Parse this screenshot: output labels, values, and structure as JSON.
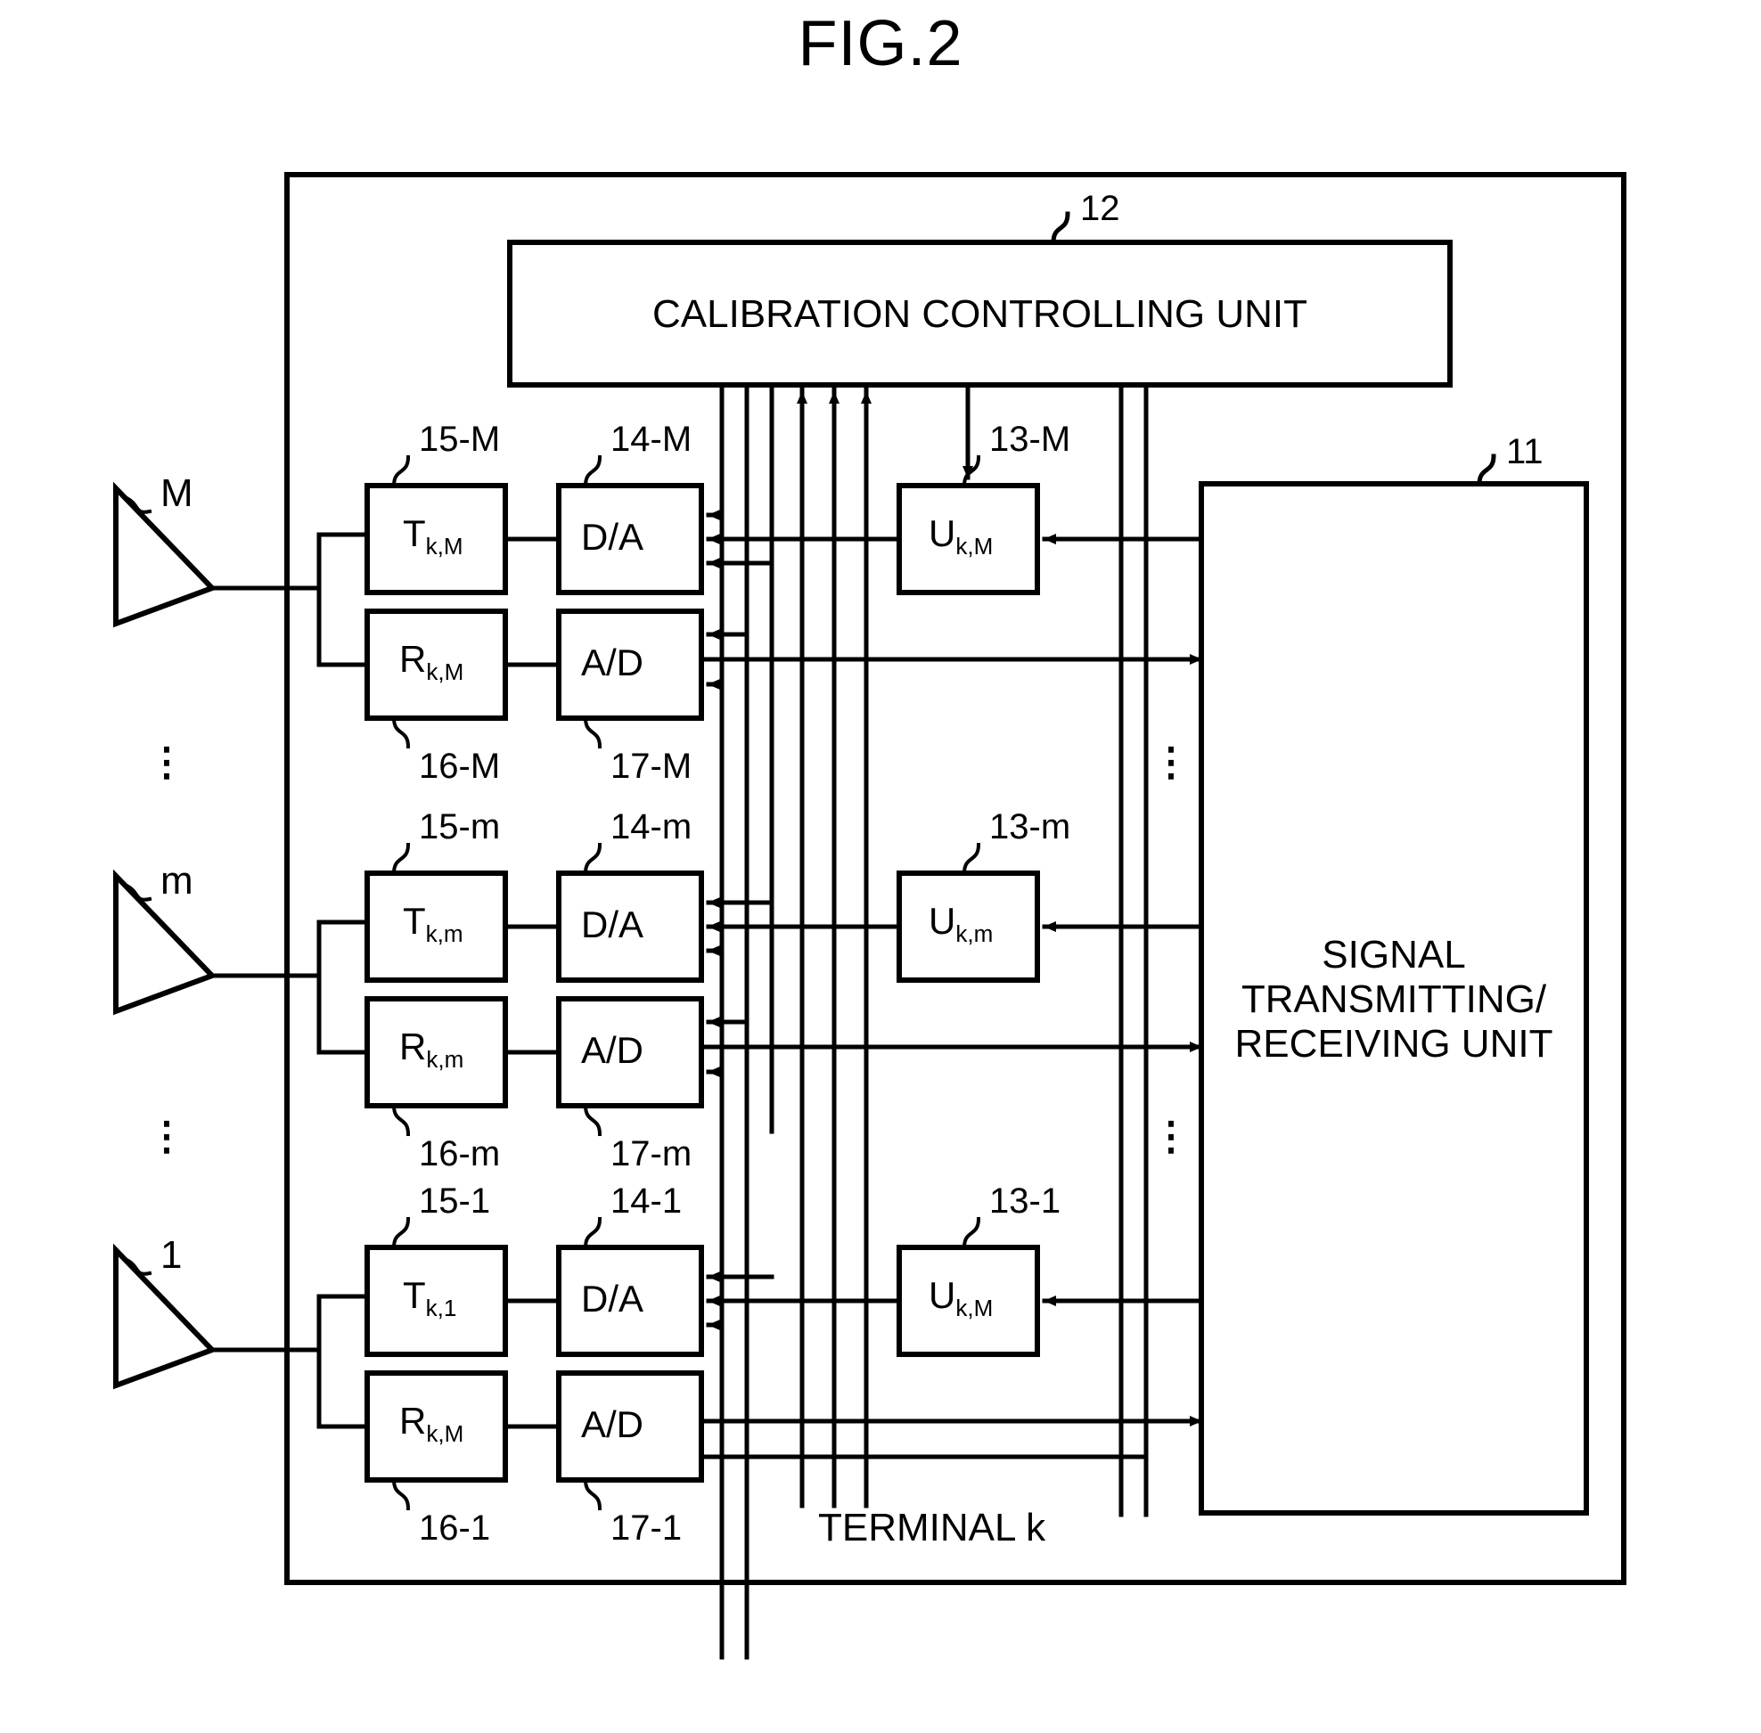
{
  "figure": {
    "title": "FIG.2",
    "terminal_label": "TERMINAL k"
  },
  "outer_box": {
    "name": "terminal-k-enclosure"
  },
  "calibration_unit": {
    "label": "CALIBRATION CONTROLLING UNIT",
    "ref": "12"
  },
  "signal_unit": {
    "line1": "SIGNAL",
    "line2": "TRANSMITTING/",
    "line3": "RECEIVING UNIT",
    "ref": "11"
  },
  "antennas": [
    {
      "label": "M"
    },
    {
      "label": "m"
    },
    {
      "label": "1"
    }
  ],
  "rows": [
    {
      "id": "M",
      "tx": {
        "label": "T",
        "sub": "k,M",
        "ref": "15-M"
      },
      "da": {
        "label": "D/A",
        "ref": "14-M"
      },
      "rx": {
        "label": "R",
        "sub": "k,M",
        "ref": "16-M"
      },
      "ad": {
        "label": "A/D",
        "ref": "17-M"
      },
      "u": {
        "label": "U",
        "sub": "k,M",
        "ref": "13-M"
      }
    },
    {
      "id": "m",
      "tx": {
        "label": "T",
        "sub": "k,m",
        "ref": "15-m"
      },
      "da": {
        "label": "D/A",
        "ref": "14-m"
      },
      "rx": {
        "label": "R",
        "sub": "k,m",
        "ref": "16-m"
      },
      "ad": {
        "label": "A/D",
        "ref": "17-m"
      },
      "u": {
        "label": "U",
        "sub": "k,m",
        "ref": "13-m"
      }
    },
    {
      "id": "1",
      "tx": {
        "label": "T",
        "sub": "k,1",
        "ref": "15-1"
      },
      "da": {
        "label": "D/A",
        "ref": "14-1"
      },
      "rx": {
        "label": "R",
        "sub": "k,M",
        "ref": "16-1"
      },
      "ad": {
        "label": "A/D",
        "ref": "17-1"
      },
      "u": {
        "label": "U",
        "sub": "k,M",
        "ref": "13-1"
      }
    }
  ],
  "ellipses": {
    "glyph": "⋮"
  },
  "colors": {
    "ink": "#000000",
    "paper": "#ffffff"
  }
}
